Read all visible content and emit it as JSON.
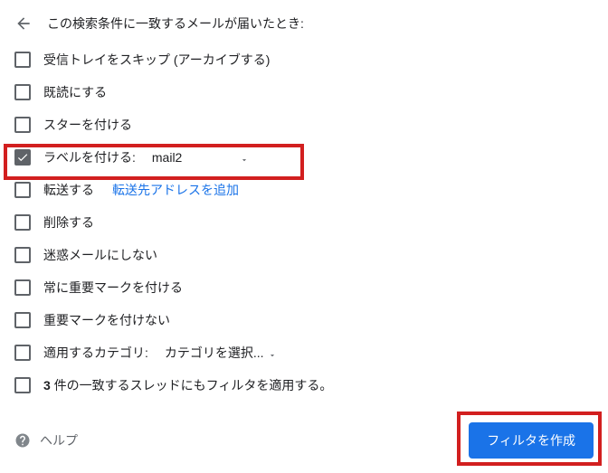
{
  "header": {
    "title": "この検索条件に一致するメールが届いたとき:"
  },
  "options": {
    "skip_inbox": "受信トレイをスキップ (アーカイブする)",
    "mark_read": "既読にする",
    "star": "スターを付ける",
    "apply_label_prefix": "ラベルを付ける:",
    "apply_label_value": "mail2",
    "forward": "転送する",
    "forward_link": "転送先アドレスを追加",
    "delete": "削除する",
    "never_spam": "迷惑メールにしない",
    "always_important": "常に重要マークを付ける",
    "never_important": "重要マークを付けない",
    "apply_category_prefix": "適用するカテゴリ:",
    "apply_category_value": "カテゴリを選択...",
    "also_apply_prefix": "3",
    "also_apply_suffix": " 件の一致するスレッドにもフィルタを適用する。"
  },
  "footer": {
    "help": "ヘルプ",
    "create": "フィルタを作成"
  }
}
